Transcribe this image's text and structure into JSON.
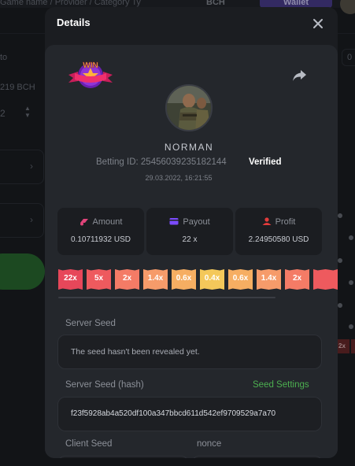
{
  "background": {
    "breadcrumb": "Game name / Provider / Category Ty",
    "currency_chip": "BCH",
    "wallet_label": "Wallet",
    "to_label": "to",
    "balance_value": "219 BCH",
    "stepper_value": "2",
    "right_value": "0",
    "red_chip": "2x"
  },
  "modal": {
    "title": "Details",
    "badge_text": "WIN",
    "player": {
      "username": "NORMAN",
      "betting_id_label": "Betting ID:",
      "betting_id": "25456039235182144",
      "verified_label": "Verified",
      "date": "29.03.2022, 16:21:55"
    },
    "stats": [
      {
        "label": "Amount",
        "value": "0.10711932 USD",
        "icon": "amount-icon",
        "color": "#e0447a"
      },
      {
        "label": "Payout",
        "value": "22 x",
        "icon": "wallet-icon",
        "color": "#7b4bff"
      },
      {
        "label": "Profit",
        "value": "2.24950580 USD",
        "icon": "profit-icon",
        "color": "#e23b3b"
      }
    ],
    "multipliers": [
      {
        "label": "22x",
        "color": "#e7475a"
      },
      {
        "label": "5x",
        "color": "#ee5a5e"
      },
      {
        "label": "2x",
        "color": "#f47b66"
      },
      {
        "label": "1.4x",
        "color": "#f69b6a"
      },
      {
        "label": "0.6x",
        "color": "#f6ae62"
      },
      {
        "label": "0.4x",
        "color": "#f4c85a"
      },
      {
        "label": "0.6x",
        "color": "#f6ae62"
      },
      {
        "label": "1.4x",
        "color": "#f69b6a"
      },
      {
        "label": "2x",
        "color": "#f47b66"
      },
      {
        "label": "",
        "color": "#ee5a5e"
      }
    ],
    "server_seed_label": "Server Seed",
    "server_seed_value": "The seed hasn't been revealed yet.",
    "server_seed_hash_label": "Server Seed (hash)",
    "seed_settings_label": "Seed Settings",
    "server_seed_hash_value": "f23f5928ab4a520df100a347bbcd611d542ef9709529a7a70",
    "client_seed_label": "Client Seed",
    "nonce_label": "nonce"
  }
}
